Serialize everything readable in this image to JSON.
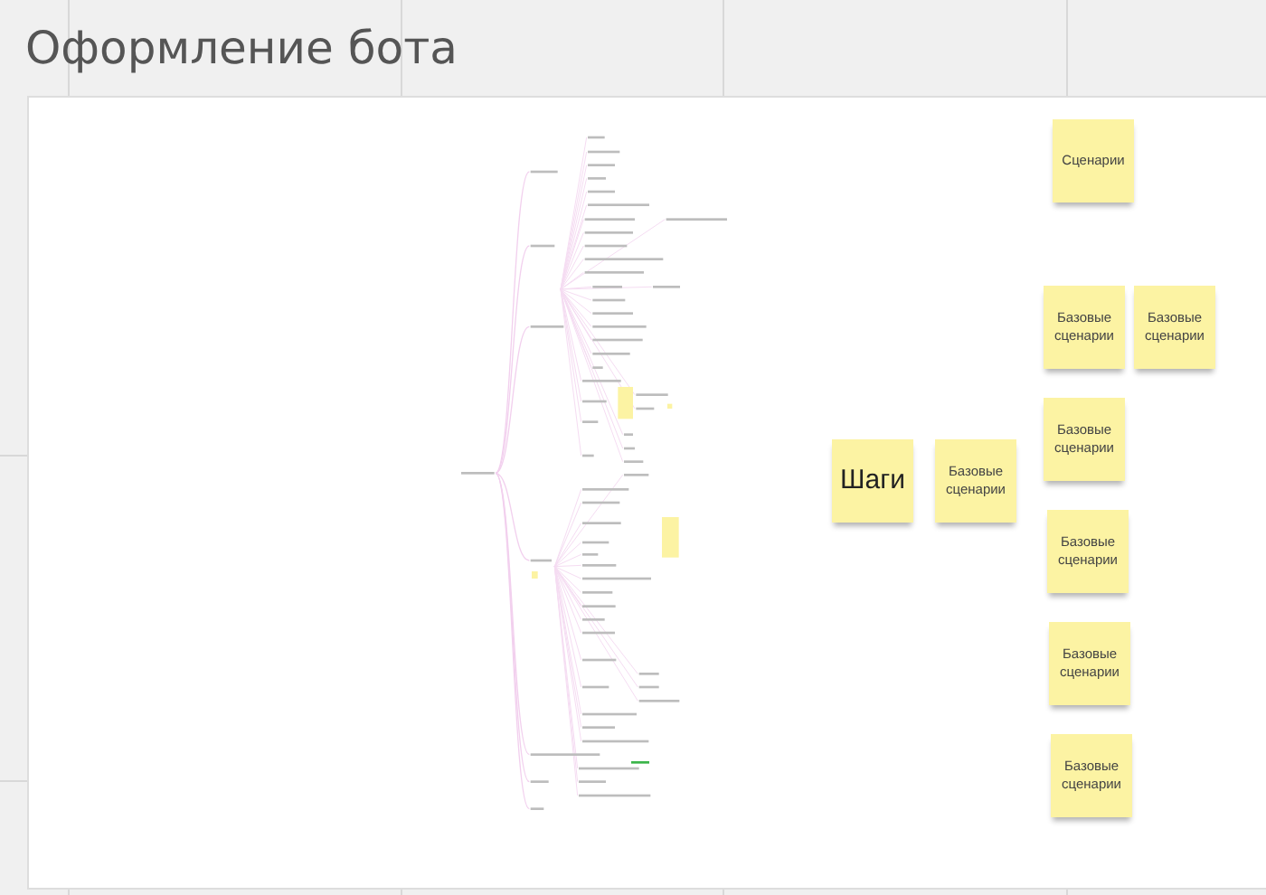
{
  "board": {
    "title": "Оформление бота"
  },
  "stickies": [
    {
      "kind": "note",
      "text": "Сценарии"
    },
    {
      "kind": "note",
      "text": "Базовые сценарии"
    },
    {
      "kind": "note",
      "text": "Базовые сценарии"
    },
    {
      "kind": "heading",
      "text": "Шаги"
    },
    {
      "kind": "note",
      "text": "Базовые сценарии"
    },
    {
      "kind": "note",
      "text": "Базовые сценарии"
    },
    {
      "kind": "note",
      "text": "Базовые сценарии"
    },
    {
      "kind": "note",
      "text": "Базовые сценарии"
    },
    {
      "kind": "note",
      "text": "Базовые сценарии"
    }
  ]
}
